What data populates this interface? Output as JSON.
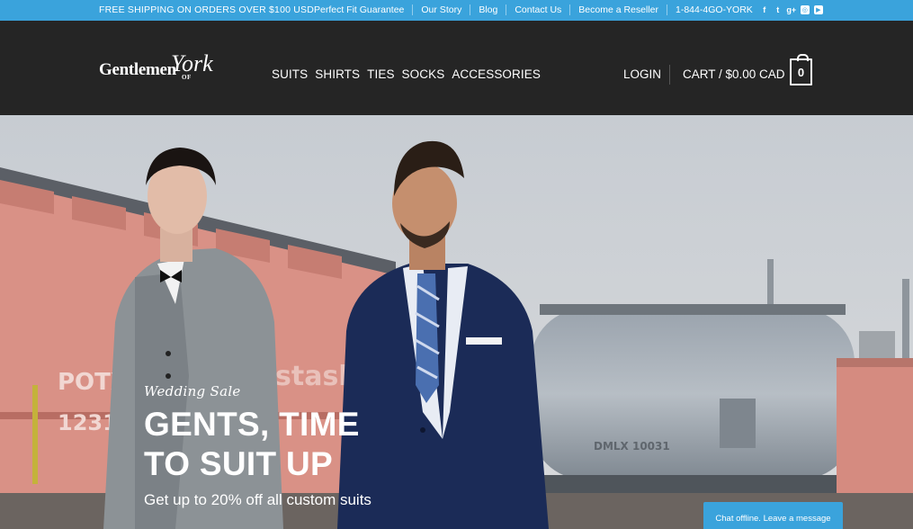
{
  "topbar": {
    "shipping": "FREE SHIPPING ON ORDERS OVER $100 USD",
    "links": [
      "Perfect Fit Guarantee",
      "Our Story",
      "Blog",
      "Contact Us",
      "Become a Reseller"
    ],
    "phone": "1-844-4GO-YORK",
    "social": [
      {
        "icon": "facebook-icon",
        "glyph": "f"
      },
      {
        "icon": "twitter-icon",
        "glyph": "t"
      },
      {
        "icon": "google-plus-icon",
        "glyph": "g+"
      },
      {
        "icon": "instagram-icon",
        "glyph": "◎"
      },
      {
        "icon": "youtube-icon",
        "glyph": "▶"
      }
    ]
  },
  "header": {
    "logo_main": "Gentlemen",
    "logo_of": "OF",
    "logo_script": "York",
    "nav": [
      "SUITS",
      "SHIRTS",
      "TIES",
      "SOCKS",
      "ACCESSORIES"
    ],
    "login": "LOGIN",
    "cart": "CART / $0.00 CAD",
    "cart_count": "0"
  },
  "hero": {
    "script": "Wedding Sale",
    "headline_line1": "GENTS, TIME",
    "headline_line2": "TO SUIT UP",
    "sub": "Get up to 20% off all custom suits",
    "railcar_texts": [
      "POTX",
      "1231",
      "stash",
      "DMLX 10031"
    ]
  },
  "chat": {
    "label": "Chat offline. Leave a message"
  },
  "colors": {
    "accent": "#3aa3dc",
    "header": "#252525"
  }
}
